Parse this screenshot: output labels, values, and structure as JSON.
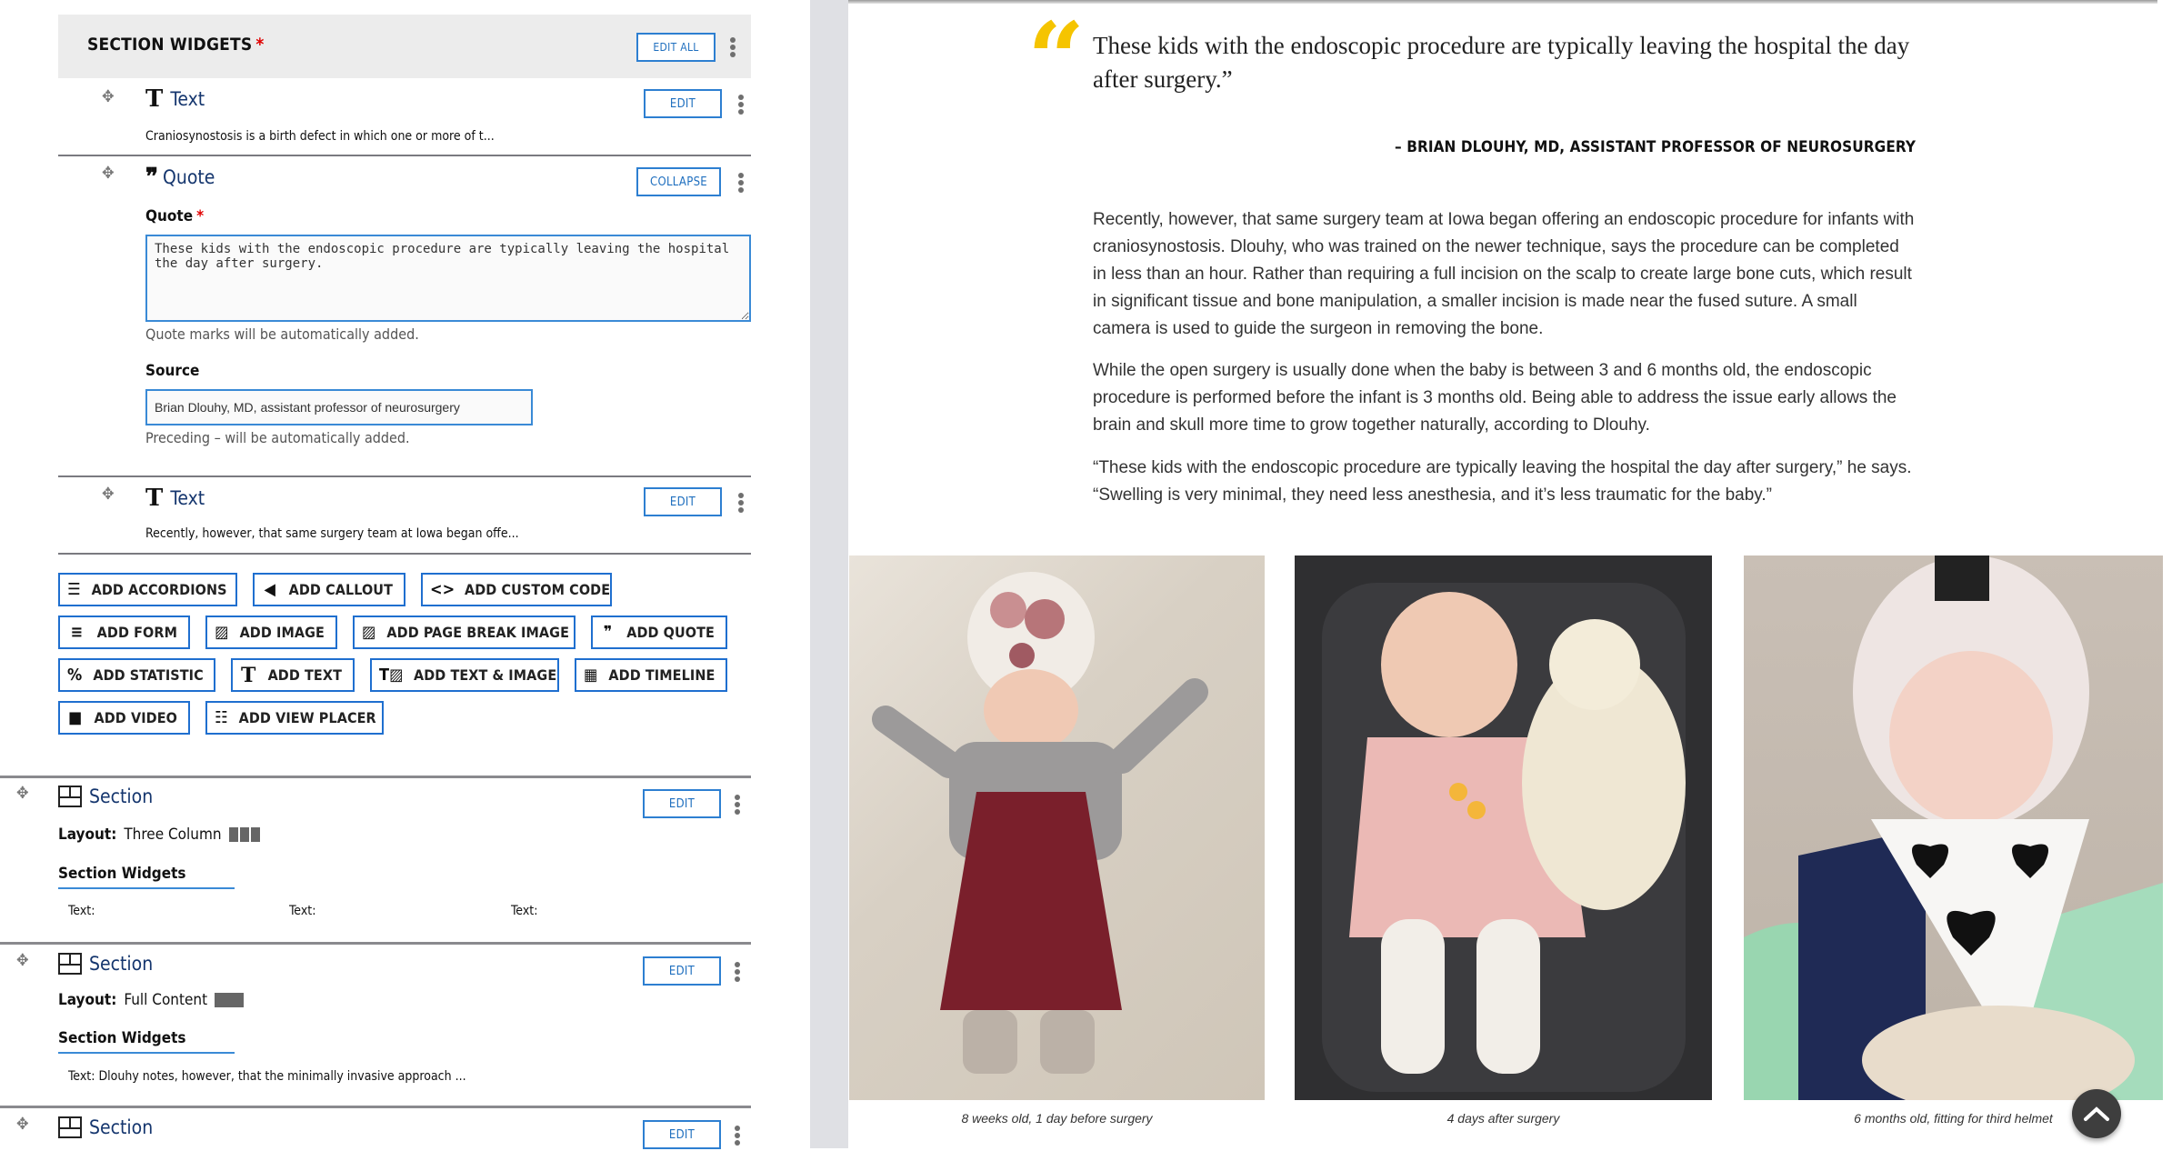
{
  "editor": {
    "section_widgets_header": {
      "title": "SECTION WIDGETS",
      "required_mark": "*",
      "edit_all_label": "EDIT ALL"
    },
    "widgets": [
      {
        "type": "Text",
        "icon": "text-icon",
        "summary": "Craniosynostosis is a birth defect in which one or more of t...",
        "button": "EDIT"
      },
      {
        "type": "Quote",
        "icon": "quote-icon",
        "button": "COLLAPSE",
        "quote_label": "Quote",
        "quote_required": "*",
        "quote_value": "These kids with the endoscopic procedure are typically leaving the hospital the day after surgery.",
        "quote_help": "Quote marks will be automatically added.",
        "source_label": "Source",
        "source_value": "Brian Dlouhy, MD, assistant professor of neurosurgery",
        "source_help": "Preceding – will be automatically added."
      },
      {
        "type": "Text",
        "icon": "text-icon",
        "summary": "Recently, however, that same surgery team at Iowa began offe...",
        "button": "EDIT"
      }
    ],
    "add_buttons": [
      [
        {
          "label": "ADD ACCORDIONS",
          "icon": "accordion-icon"
        },
        {
          "label": "ADD CALLOUT",
          "icon": "megaphone-icon"
        },
        {
          "label": "ADD CUSTOM CODE",
          "icon": "code-icon"
        }
      ],
      [
        {
          "label": "ADD FORM",
          "icon": "form-icon"
        },
        {
          "label": "ADD IMAGE",
          "icon": "image-icon"
        },
        {
          "label": "ADD PAGE BREAK IMAGE",
          "icon": "image-icon"
        },
        {
          "label": "ADD QUOTE",
          "icon": "quote-icon"
        }
      ],
      [
        {
          "label": "ADD STATISTIC",
          "icon": "percent-icon"
        },
        {
          "label": "ADD TEXT",
          "icon": "text-icon"
        },
        {
          "label": "ADD TEXT & IMAGE",
          "icon": "text-image-icon"
        },
        {
          "label": "ADD TIMELINE",
          "icon": "calendar-icon"
        }
      ],
      [
        {
          "label": "ADD VIDEO",
          "icon": "video-icon"
        },
        {
          "label": "ADD VIEW PLACER",
          "icon": "list-icon"
        }
      ]
    ],
    "sections": [
      {
        "title": "Section",
        "button": "EDIT",
        "layout_label": "Layout:",
        "layout_value": "Three Column",
        "widgets_label": "Section Widgets",
        "widget_texts": [
          "Text:",
          "Text:",
          "Text:"
        ]
      },
      {
        "title": "Section",
        "button": "EDIT",
        "layout_label": "Layout:",
        "layout_value": "Full Content",
        "widgets_label": "Section Widgets",
        "widget_texts": [
          "Text:  Dlouhy notes, however, that the minimally invasive approach ..."
        ]
      },
      {
        "title": "Section",
        "button": "EDIT"
      }
    ]
  },
  "preview": {
    "quote_mark": "“",
    "pull_quote": "These kids with the endoscopic procedure are typically leaving the hospital the day after surgery.”",
    "attribution": "– BRIAN DLOUHY, MD, ASSISTANT PROFESSOR OF NEUROSURGERY",
    "paragraphs": [
      "Recently, however, that same surgery team at Iowa began offering an endoscopic procedure for infants with craniosynostosis. Dlouhy, who was trained on the newer technique, says the procedure can be completed in less than an hour. Rather than requiring a full incision on the scalp to create large bone cuts, which result in significant tissue and bone manipulation, a smaller incision is made near the fused suture. A small camera is used to guide the surgeon in removing the bone.",
      "While the open surgery is usually done when the baby is between 3 and 6 months old, the endoscopic procedure is performed before the infant is 3 months old. Being able to address the issue early allows the brain and skull more time to grow together naturally, according to Dlouhy.",
      "“These kids with the endoscopic procedure are typically leaving the hospital the day after surgery,” he says. “Swelling is very minimal, they need less anesthesia, and it’s less traumatic for the baby.”"
    ],
    "photos": [
      {
        "caption": "8 weeks old, 1 day before surgery",
        "alt": "Infant in floral helmet and red dress"
      },
      {
        "caption": "4 days after surgery",
        "alt": "Sleeping infant in car seat with stuffed lamb"
      },
      {
        "caption": "6 months old, fitting for third helmet",
        "alt": "Infant in white cap with heart bib"
      }
    ],
    "scroll_top_icon": "chevron-up-icon"
  },
  "colors": {
    "accent_blue": "#1f6fcf",
    "title_navy": "#15366e",
    "quote_yellow": "#f5c400",
    "required_red": "#e00000"
  }
}
